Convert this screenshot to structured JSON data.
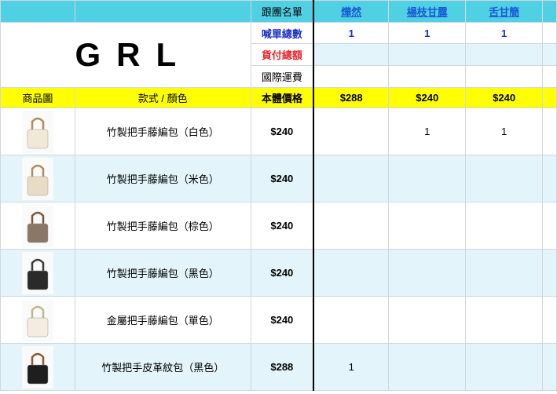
{
  "header": {
    "title_label": "跟團名單",
    "buyers": [
      {
        "name": "燁然",
        "bg": "#4fd1e3"
      },
      {
        "name": "楊枝甘露",
        "bg": "#4fd1e3"
      },
      {
        "name": "舌甘簡",
        "bg": "#4fd1e3"
      }
    ],
    "summary_rows": [
      {
        "label": "喊單總數",
        "style": "blue",
        "values": [
          "1",
          "1",
          "1"
        ]
      },
      {
        "label": "貨付總額",
        "style": "red",
        "values": [
          "",
          "",
          ""
        ]
      },
      {
        "label": "國際運費",
        "style": "plain",
        "values": [
          "",
          "",
          ""
        ]
      }
    ],
    "brand": "GRL"
  },
  "column_headers": {
    "image": "商品圖",
    "style_color": "款式 / 顏色",
    "price": "本體價格",
    "buyer_totals": [
      "$288",
      "$240",
      "$240"
    ]
  },
  "items": [
    {
      "name": "竹製把手藤編包（白色）",
      "price": "$240",
      "qty": [
        "",
        "1",
        "1"
      ],
      "bag_color": "#f1e9d8",
      "handle_color": "#b58a5a"
    },
    {
      "name": "竹製把手藤編包（米色）",
      "price": "$240",
      "qty": [
        "",
        "",
        ""
      ],
      "bag_color": "#e8dcc4",
      "handle_color": "#b58a5a"
    },
    {
      "name": "竹製把手藤編包（棕色）",
      "price": "$240",
      "qty": [
        "",
        "",
        ""
      ],
      "bag_color": "#8a7766",
      "handle_color": "#7a5538"
    },
    {
      "name": "竹製把手藤編包（黑色）",
      "price": "$240",
      "qty": [
        "",
        "",
        ""
      ],
      "bag_color": "#2a2a2a",
      "handle_color": "#3a3a3a"
    },
    {
      "name": "金屬把手藤編包（單色）",
      "price": "$240",
      "qty": [
        "",
        "",
        ""
      ],
      "bag_color": "#f3ecdf",
      "handle_color": "#c9b48a"
    },
    {
      "name": "竹製把手皮革紋包（黑色）",
      "price": "$288",
      "qty": [
        "1",
        "",
        ""
      ],
      "bag_color": "#1e1e1e",
      "handle_color": "#8b5a2b"
    }
  ]
}
